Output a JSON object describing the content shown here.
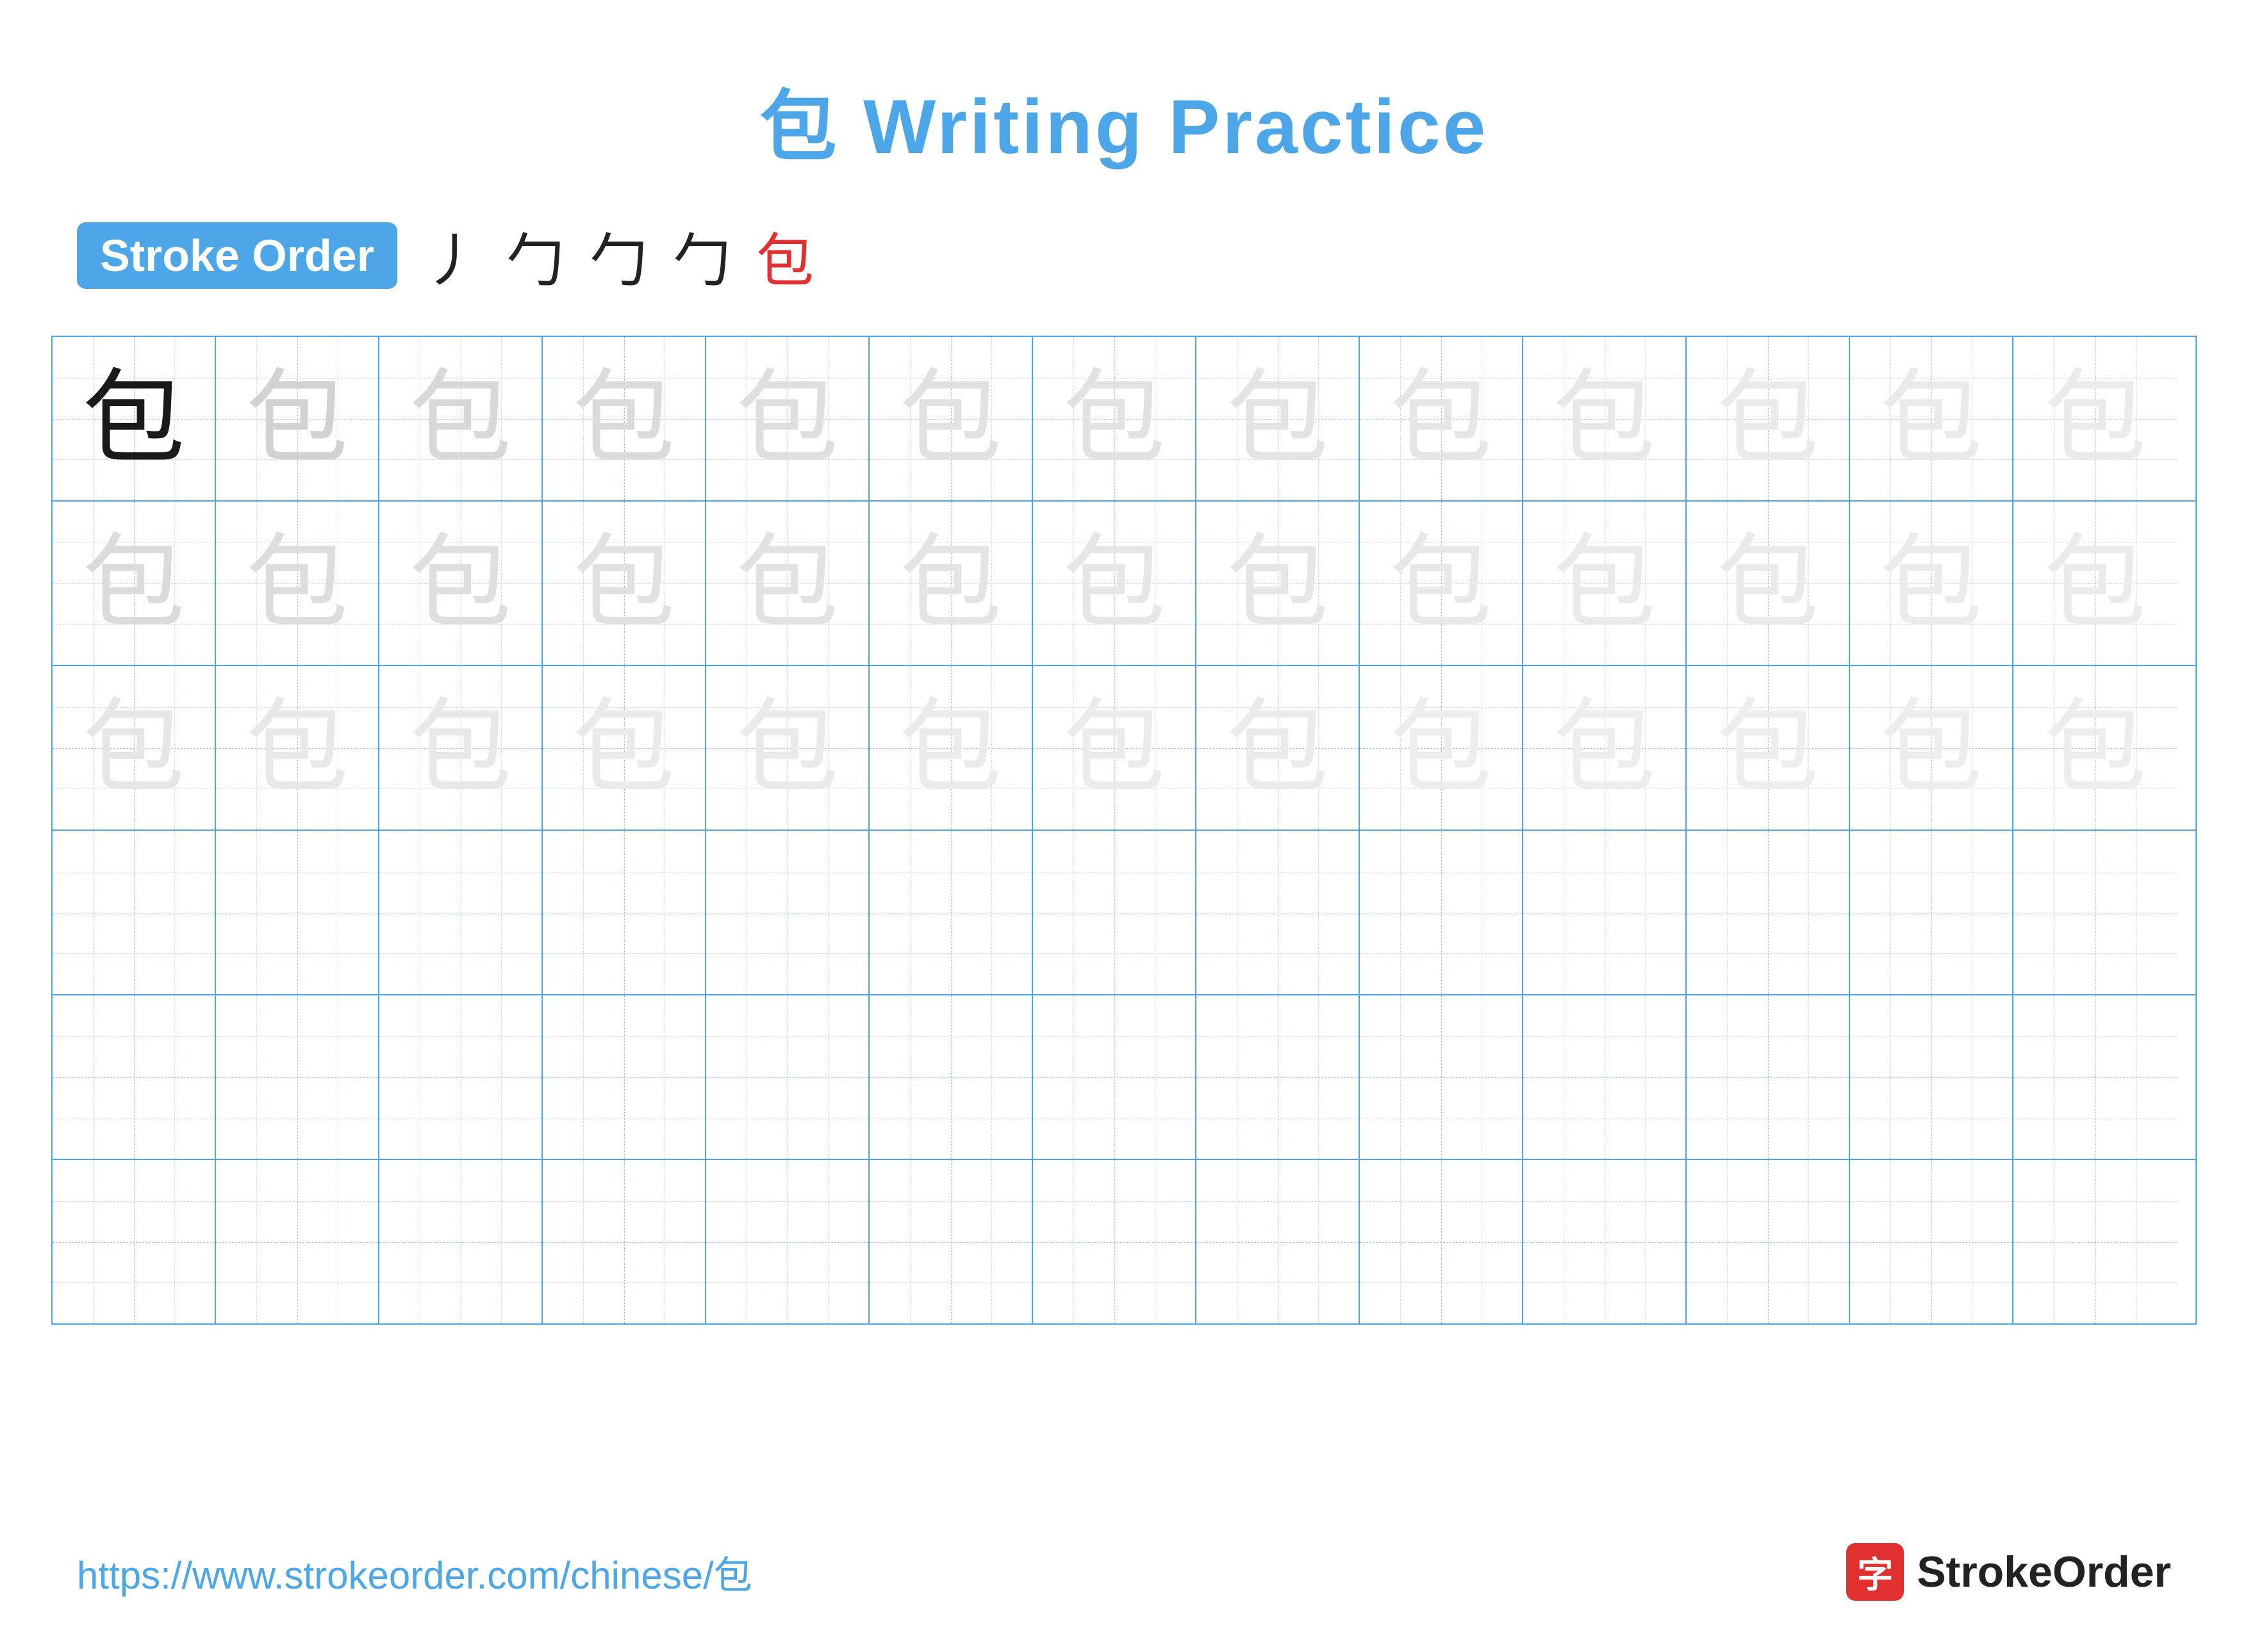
{
  "title": {
    "char": "包",
    "rest": " Writing Practice"
  },
  "stroke_order": {
    "badge_label": "Stroke Order",
    "strokes": [
      "丿",
      "勹",
      "勹",
      "勹",
      "包"
    ]
  },
  "grid": {
    "rows": 6,
    "cols": 13,
    "character": "包",
    "row_types": [
      "dark_then_light",
      "light",
      "lighter",
      "empty",
      "empty",
      "empty"
    ]
  },
  "footer": {
    "url": "https://www.strokeorder.com/chinese/包",
    "logo_char": "字",
    "logo_label": "StrokeOrder"
  }
}
